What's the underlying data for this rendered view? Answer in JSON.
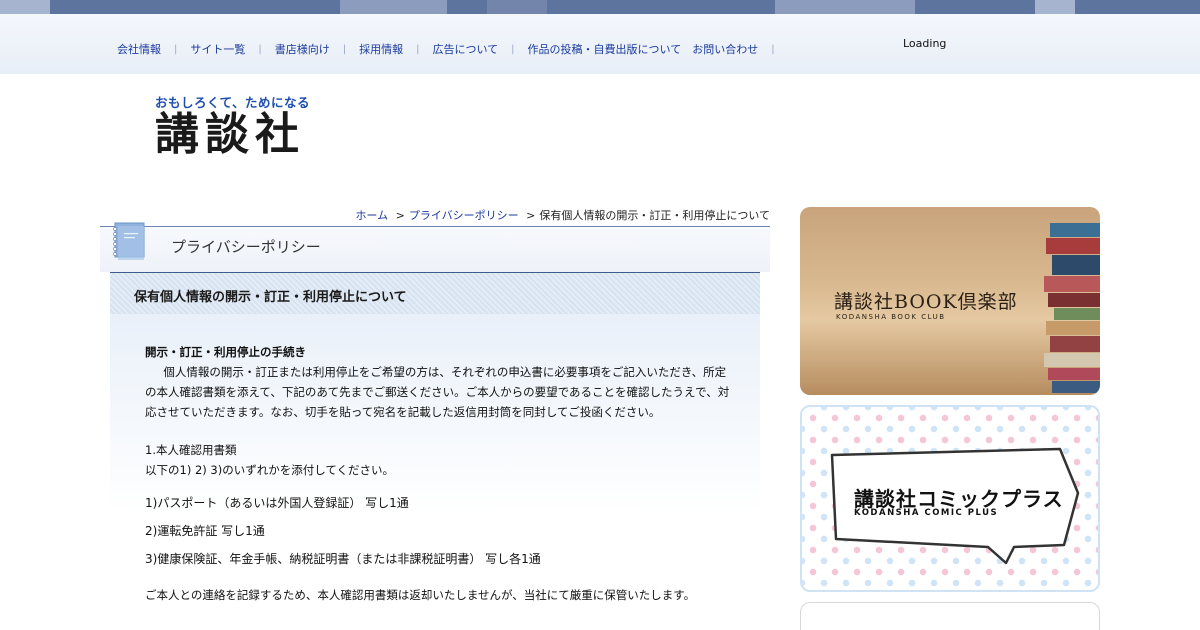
{
  "top_stripe_colors": [
    "#a7b4cf",
    "#5d759e",
    "#5d759e",
    "#5d759e",
    "#8b9cbf",
    "#5d759e",
    "#7385aa",
    "#5d759e",
    "#5d759e",
    "#8b9cbf",
    "#5d759e",
    "#5d759e",
    "#a7b4cf",
    "#5d759e"
  ],
  "header": {
    "nav": [
      {
        "label": "会社情報"
      },
      {
        "label": "サイト一覧"
      },
      {
        "label": "書店様向け"
      },
      {
        "label": "採用情報"
      },
      {
        "label": "広告について"
      },
      {
        "label": "作品の投稿・自費出版について"
      },
      {
        "label": "お問い合わせ"
      }
    ],
    "loading": "Loading"
  },
  "logo": {
    "tagline": "おもしろくて、ためになる",
    "name": "講談社"
  },
  "breadcrumb": {
    "home": "ホーム",
    "privacy": "プライバシーポリシー",
    "current": "保有個人情報の開示・訂正・利用停止について",
    "separator": ">"
  },
  "section": {
    "title": "プライバシーポリシー",
    "subtitle": "保有個人情報の開示・訂正・利用停止について"
  },
  "content": {
    "procedure_title": "開示・訂正・利用停止の手続き",
    "procedure_text": "個人情報の開示・訂正または利用停止をご希望の方は、それぞれの申込書に必要事項をご記入いただき、所定の本人確認書類を添えて、下記のあて先までご郵送ください。ご本人からの要望であることを確認したうえで、対応させていただきます。なお、切手を貼って宛名を記載した返信用封筒を同封してご投函ください。",
    "id_heading": "1.本人確認用書類",
    "id_instruction": "以下の1) 2) 3)のいずれかを添付してください。",
    "id_docs": [
      "1)パスポート（あるいは外国人登録証） 写し1通",
      "2)運転免許証 写し1通",
      "3)健康保険証、年金手帳、納税証明書（または非課税証明書） 写し各1通"
    ],
    "note": "ご本人との連絡を記録するため、本人確認用書類は返却いたしませんが、当社にて厳重に保管いたします。"
  },
  "banners": {
    "book_club": {
      "title": "講談社BOOK倶楽部",
      "subtitle": "KODANSHA BOOK CLUB"
    },
    "comic_plus": {
      "title": "講談社コミックプラス",
      "subtitle": "KODANSHA COMIC PLUS"
    }
  }
}
